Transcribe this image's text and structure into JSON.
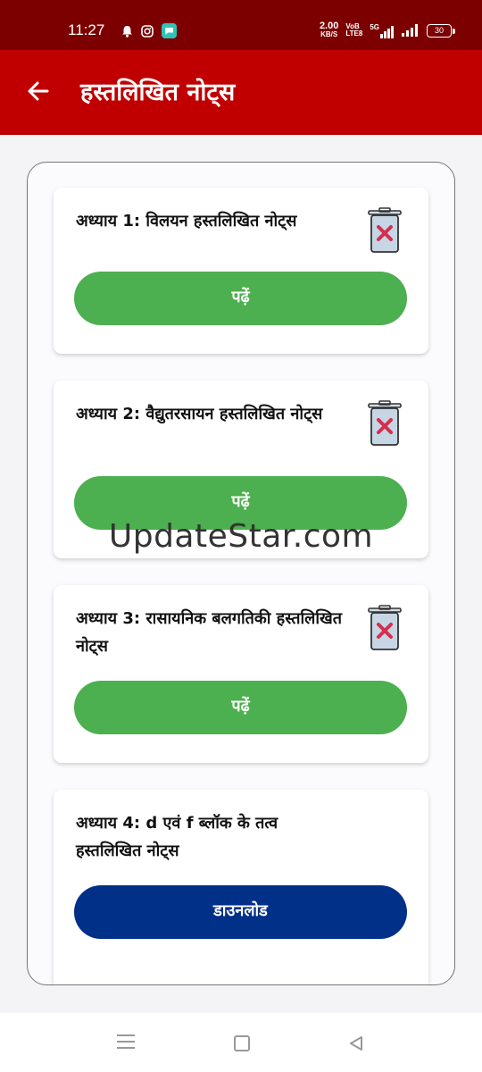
{
  "status_bar": {
    "time": "11:27",
    "speed_value": "2.00",
    "speed_unit": "KB/S",
    "volte": "VoB",
    "volte_sub": "LTE8",
    "network": "5G",
    "battery": "30"
  },
  "app_bar": {
    "title": "हस्तलिखित नोट्स"
  },
  "chapters": [
    {
      "title": "अध्याय 1: विलयन हस्तलिखित नोट्स",
      "button_label": "पढ़ें",
      "downloaded": true
    },
    {
      "title": "अध्याय 2: वैद्युतरसायन हस्तलिखित नोट्स",
      "button_label": "पढ़ें",
      "downloaded": true
    },
    {
      "title": "अध्याय 3: रासायनिक बलगतिकी हस्तलिखित नोट्स",
      "button_label": "पढ़ें",
      "downloaded": true
    },
    {
      "title": "अध्याय 4: d एवं f ब्लॉक के तत्व हस्तलिखित नोट्स",
      "button_label": "डाउनलोड",
      "downloaded": false
    }
  ],
  "watermark": "UpdateStar.com",
  "colors": {
    "status_bar": "#7c0000",
    "app_bar": "#c00000",
    "read_button": "#4caf50",
    "download_button": "#003087",
    "delete_icon": "#d32f4f"
  }
}
